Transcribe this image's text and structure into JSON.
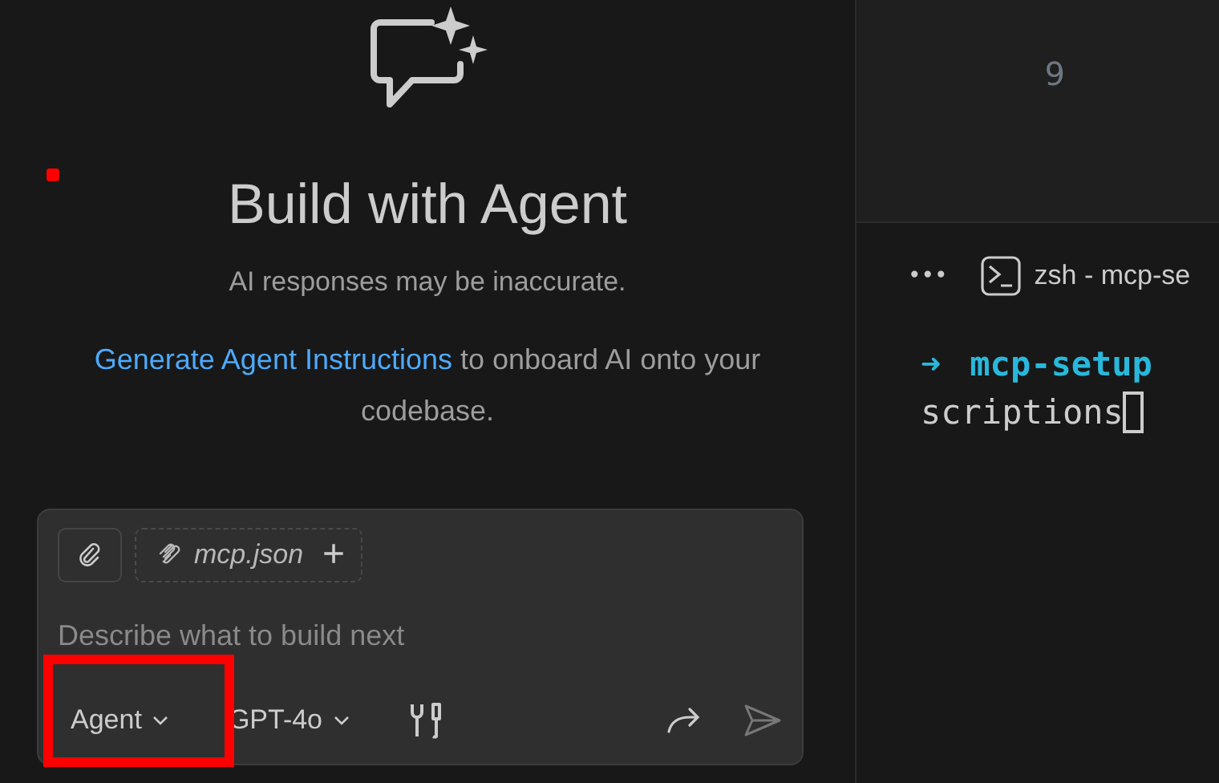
{
  "chat": {
    "title": "Build with Agent",
    "disclaimer": "AI responses may be inaccurate.",
    "onboard": {
      "link": "Generate Agent Instructions",
      "text": " to onboard AI onto your codebase."
    },
    "input": {
      "context_file": "mcp.json",
      "add_symbol": "+",
      "placeholder": "Describe what to build next",
      "mode": "Agent",
      "model": "GPT-4o"
    },
    "annotation_dot": {
      "color": "#ff0000"
    },
    "highlight_frame": {
      "color": "#ff0000"
    }
  },
  "editor": {
    "line_number": "9"
  },
  "terminal": {
    "more": "•••",
    "tab": "zsh - mcp-se",
    "lines": [
      {
        "kind": "prompt",
        "symbol": "➜",
        "text": "mcp-setup"
      },
      {
        "kind": "output",
        "text": "scriptions"
      }
    ]
  }
}
